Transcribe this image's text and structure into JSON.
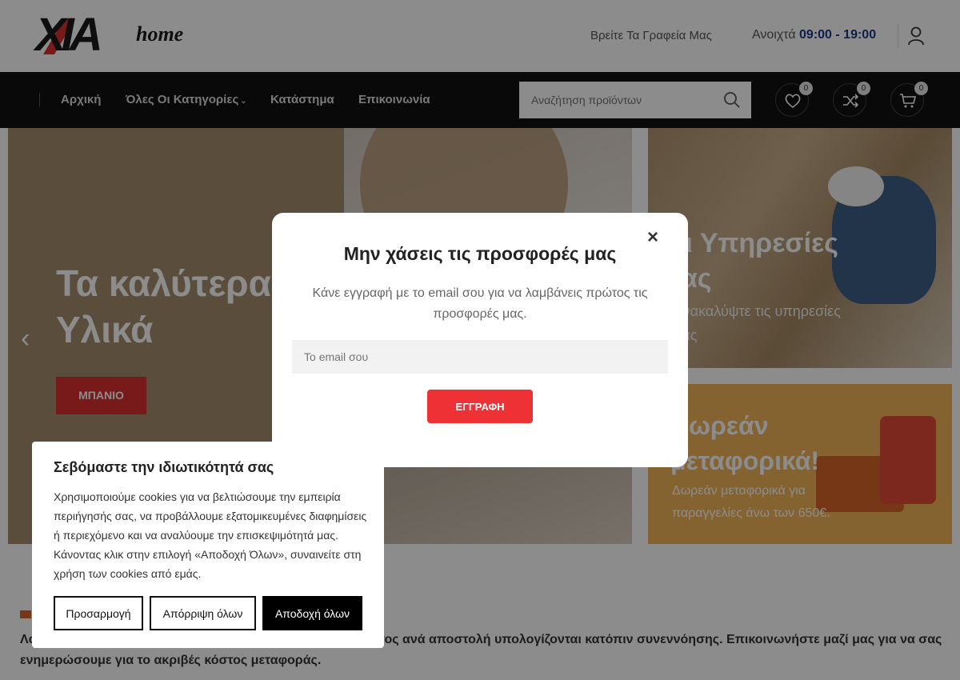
{
  "header": {
    "logo_text": "XIA",
    "logo_suffix": "home",
    "find_offices": "Βρείτε Τα Γραφεία Μας",
    "hours_label": "Ανοιχτά",
    "hours_value": "09:00 - 19:00"
  },
  "nav": {
    "items": [
      {
        "label": "Αρχική"
      },
      {
        "label": "Όλες Οι Κατηγορίες"
      },
      {
        "label": "Κατάστημα"
      },
      {
        "label": "Επικοινωνία"
      }
    ],
    "search_placeholder": "Αναζήτηση προϊόντων",
    "wishlist_count": "0",
    "compare_count": "0",
    "cart_count": "0"
  },
  "hero": {
    "title_line1": "Τα καλύτερα",
    "title_line2": "Υλικά",
    "button_label": "ΜΠΑΝΙΟ"
  },
  "services_banner": {
    "title_line1": "Οι Υπηρεσίες",
    "title_line2": "μας",
    "subtitle_line1": "Ανακαλύψτε τις υπηρεσίες",
    "subtitle_line2": "μας"
  },
  "delivery_banner": {
    "title_line1": "Δωρεάν",
    "title_line2": "μεταφορικά!",
    "subtitle_line1": "Δωρεάν μεταφορικά για",
    "subtitle_line2": "παραγγελίες άνω των 650€."
  },
  "shipping_notice": "Λοιπά μεταφορικά για παραγγελίες εκτός περιοχής και κόστος ανά αποστολή υπολογίζονται κατόπιν συνεννόησης. Επικοινωνήστε μαζί μας για να σας ενημερώσουμε για το ακριβές κόστος μεταφοράς.",
  "popup": {
    "close_symbol": "×",
    "title": "Μην χάσεις τις προσφορές μας",
    "description": "Κάνε εγγραφή με το email σου για να λαμβάνεις πρώτος τις προσφορές μας.",
    "email_placeholder": "Το email σου",
    "submit_label": "ΕΓΓΡΑΦΗ"
  },
  "cookie_banner": {
    "title": "Σεβόμαστε την ιδιωτικότητά σας",
    "text": "Χρησιμοποιούμε cookies για να βελτιώσουμε την εμπειρία περιήγησής σας, να προβάλλουμε εξατομικευμένες διαφημίσεις ή περιεχόμενο και να αναλύουμε την επισκεψιμότητά μας. Κάνοντας κλικ στην επιλογή «Αποδοχή Όλων», συναινείτε στη χρήση των cookies από εμάς.",
    "customize_label": "Προσαρμογή",
    "reject_label": "Απόρριψη όλων",
    "accept_label": "Αποδοχή όλων"
  },
  "colors": {
    "brand_red": "#d9312f",
    "hours_blue": "#1a3a8a",
    "nav_bg": "#111111",
    "popup_button": "#ee3135"
  }
}
